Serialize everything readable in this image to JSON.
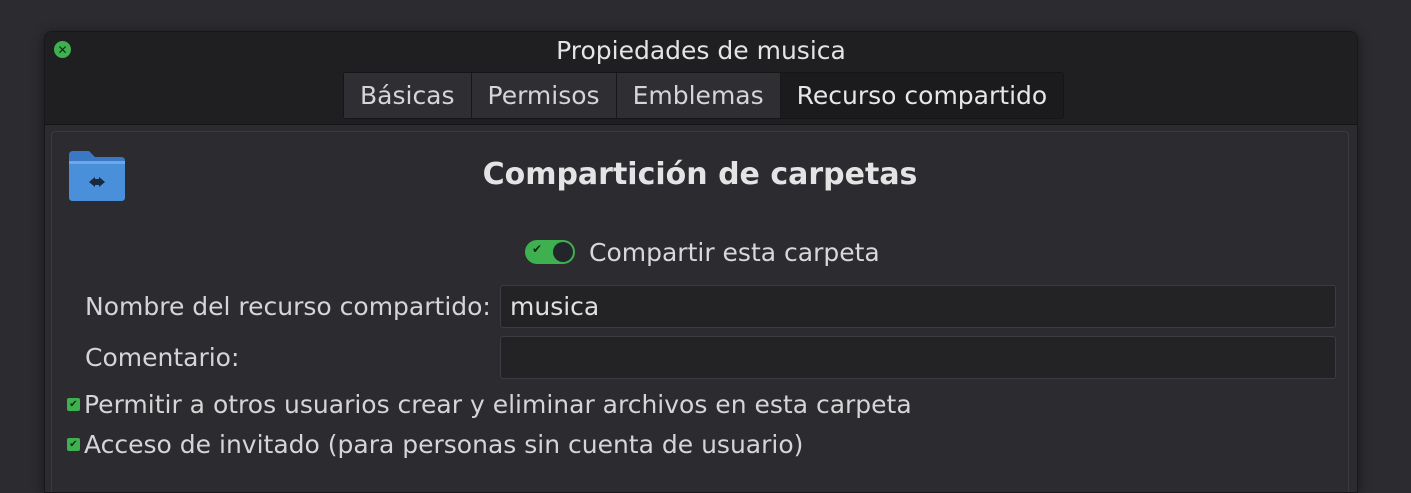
{
  "window": {
    "title": "Propiedades de musica",
    "close_glyph": "✕"
  },
  "tabs": [
    {
      "label": "Básicas",
      "active": false
    },
    {
      "label": "Permisos",
      "active": false
    },
    {
      "label": "Emblemas",
      "active": false
    },
    {
      "label": "Recurso compartido",
      "active": true
    }
  ],
  "share": {
    "icon": "folder-share-icon",
    "heading": "Compartición de carpetas",
    "toggle_label": "Compartir esta carpeta",
    "toggle_on": true,
    "name_label": "Nombre del recurso compartido:",
    "name_value": "musica",
    "comment_label": "Comentario:",
    "comment_value": "",
    "allow_label": "Permitir a otros usuarios crear y eliminar archivos en esta carpeta",
    "allow_checked": true,
    "guest_label": "Acceso de invitado (para personas sin cuenta de usuario)",
    "guest_checked": true
  },
  "colors": {
    "accent": "#3fb04f",
    "folder": "#4a8fd9",
    "background": "#2b2b30",
    "titlebar": "#1f1f22"
  }
}
